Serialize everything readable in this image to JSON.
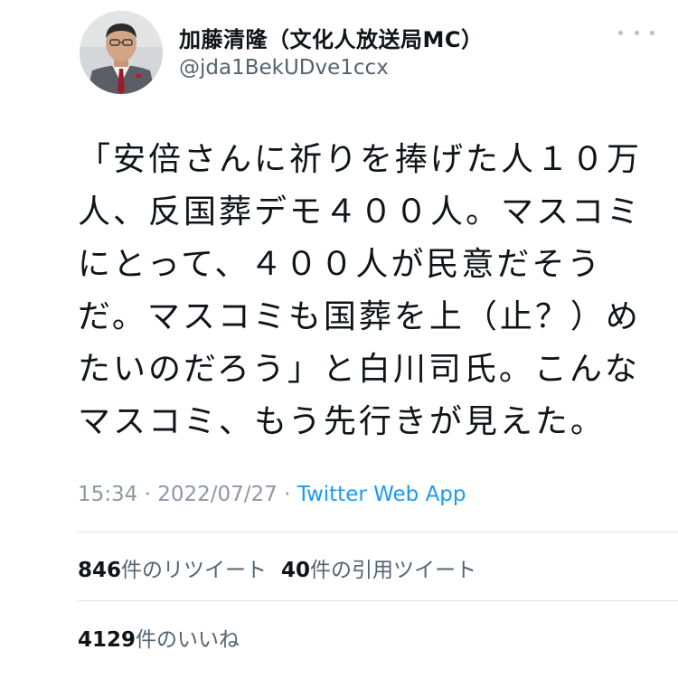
{
  "user": {
    "display_name": "加藤清隆（文化人放送局MC）",
    "handle": "@jda1BekUDve1ccx",
    "avatar_icon": "profile-photo-icon",
    "more_icon": "more-options-icon"
  },
  "tweet": {
    "lines": [
      "「安倍さんに祈りを捧げた人１０万",
      "人、反国葬デモ４００人。マスコミ",
      "にとって、４００人が民意だそう",
      "だ。マスコミも国葬を上（止？）め",
      "たいのだろう」と白川司氏。こんな",
      "マスコミ、もう先行きが見えた。"
    ]
  },
  "meta": {
    "timestamp": "15:34 · 2022/07/27 · ",
    "source": "Twitter Web App"
  },
  "stats": {
    "retweets_count": "846",
    "retweets_label": "件のリツイート",
    "quotes_count": "40",
    "quotes_label": "件の引用ツイート",
    "likes_count": "4129",
    "likes_label": "件のいいね"
  },
  "colors": {
    "link": "#1d9bf0",
    "secondary_text": "#536471",
    "primary_text": "#0f1419"
  }
}
